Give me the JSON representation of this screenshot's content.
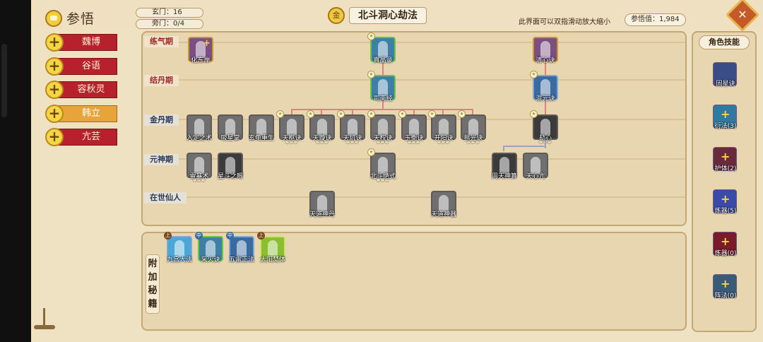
{
  "header": {
    "title": "参悟",
    "counters": [
      "玄门：16",
      "旁门：0/4"
    ],
    "main_title": "北斗洞心劫法",
    "main_title_badge": "金",
    "hint": "此界面可以双指滑动放大缩小",
    "insight": "参悟值：1,984",
    "close_symbol": "✕"
  },
  "characters": [
    {
      "name": "魏博",
      "selected": false
    },
    {
      "name": "谷语",
      "selected": false
    },
    {
      "name": "容秋灵",
      "selected": false
    },
    {
      "name": "韩立",
      "selected": true
    },
    {
      "name": "亢芸",
      "selected": false
    }
  ],
  "stages": [
    "练气期",
    "结丹期",
    "金丹期",
    "元神期",
    "在世仙人"
  ],
  "nodes": {
    "n_lq1": "化东岸",
    "n_lq2": "真晶录",
    "n_lq3": "清心诀",
    "n_jd1": "司南经",
    "n_jd2": "混元诀",
    "n_jin1": "入定之术",
    "n_jin2": "吸星掌",
    "n_jin3": "玄龟重生",
    "n_jin4": "天枢诀",
    "n_jin5": "天璇诀",
    "n_jin6": "天玑诀",
    "n_jin7": "天权诀",
    "n_jin8": "玉衡诀",
    "n_jin9": "开阳诀",
    "n_jin10": "摇光诀",
    "n_jin11": "劫心",
    "n_ys1": "雷暴术",
    "n_ys2": "星斗之眼",
    "n_ys3": "北斗绝式",
    "n_ys4": "周天神算",
    "n_ys5": "天心亢",
    "n_xr1": "天道神丹",
    "n_xr2": "天道神器"
  },
  "extra": {
    "title_chars": [
      "附",
      "加",
      "秘",
      "籍"
    ],
    "items": [
      "九宫大法",
      "采火诀",
      "五雷正法",
      "太阳焚体"
    ]
  },
  "skills": {
    "title": "角色技能",
    "items": [
      "固星诀",
      "衍法(3)",
      "护体(2)",
      "炼器(5)",
      "炼器(0)",
      "阵法(0)"
    ]
  },
  "colors": {
    "tab_red": "#b6212c",
    "tab_selected": "#e6a43a",
    "connector_red": "#e27f7f",
    "connector_grey": "#9aa7b8",
    "panel_bg": "#e8d6b0"
  }
}
